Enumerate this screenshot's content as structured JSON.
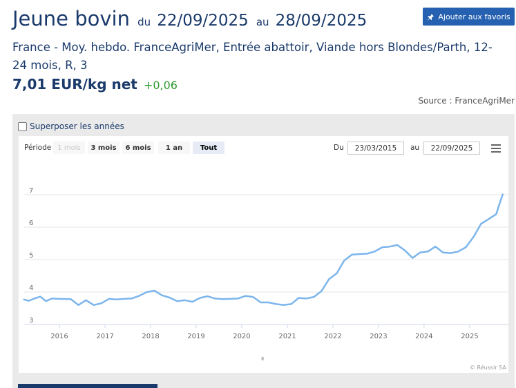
{
  "header": {
    "title": "Jeune bovin",
    "du_label": "du",
    "date_from": "22/09/2025",
    "au_label": "au",
    "date_to": "28/09/2025",
    "favorites_button": "Ajouter aux favoris",
    "subtitle": "France - Moy. hebdo. FranceAgriMer, Entrée abattoir, Viande hors Blondes/Parth, 12-24 mois, R, 3",
    "price": "7,01 EUR/kg net",
    "change": "+0,06",
    "source": "Source : FranceAgriMer"
  },
  "controls": {
    "overlay_years": "Superposer les années",
    "periode_label": "Période",
    "ranges": [
      "1 mois",
      "3 mois",
      "6 mois",
      "1 an",
      "Tout"
    ],
    "selected_range": "Tout",
    "du_label": "Du",
    "from_value": "23/03/2015",
    "au_label": "au",
    "to_value": "22/09/2025",
    "credit": "© Réussir SA",
    "navigator_handle": "III"
  },
  "colors": {
    "brand": "#1a3a6b",
    "button": "#2561b0",
    "positive": "#2e9a2e",
    "series": "#7cb5ec"
  },
  "chart_data": {
    "type": "line",
    "title": "",
    "xlabel": "",
    "ylabel": "",
    "ylim": [
      3,
      7
    ],
    "yticks": [
      3,
      4,
      5,
      6,
      7
    ],
    "xticks": [
      "2016",
      "2017",
      "2018",
      "2019",
      "2020",
      "2021",
      "2022",
      "2023",
      "2024",
      "2025"
    ],
    "grid": true,
    "series": [
      {
        "name": "",
        "x": [
          "2015-03-23",
          "2015-05-01",
          "2015-06-15",
          "2015-08-01",
          "2015-09-15",
          "2015-11-01",
          "2016-01-01",
          "2016-04-01",
          "2016-06-01",
          "2016-08-01",
          "2016-10-01",
          "2016-12-01",
          "2017-02-01",
          "2017-04-01",
          "2017-06-01",
          "2017-08-01",
          "2017-10-01",
          "2017-12-01",
          "2018-02-01",
          "2018-04-01",
          "2018-06-01",
          "2018-08-01",
          "2018-10-01",
          "2018-12-01",
          "2019-02-01",
          "2019-04-01",
          "2019-06-01",
          "2019-08-01",
          "2019-10-01",
          "2019-12-01",
          "2020-02-01",
          "2020-04-01",
          "2020-06-01",
          "2020-08-01",
          "2020-10-01",
          "2020-12-01",
          "2021-02-01",
          "2021-04-01",
          "2021-06-01",
          "2021-08-01",
          "2021-10-01",
          "2021-12-01",
          "2022-02-01",
          "2022-04-01",
          "2022-06-01",
          "2022-08-01",
          "2022-10-01",
          "2022-12-01",
          "2023-02-01",
          "2023-04-01",
          "2023-06-01",
          "2023-08-01",
          "2023-10-01",
          "2023-12-01",
          "2024-02-01",
          "2024-04-01",
          "2024-06-01",
          "2024-08-01",
          "2024-10-01",
          "2024-12-01",
          "2025-02-01",
          "2025-04-01",
          "2025-06-01",
          "2025-08-01",
          "2025-09-22"
        ],
        "values": [
          3.77,
          3.73,
          3.8,
          3.86,
          3.72,
          3.8,
          3.79,
          3.78,
          3.6,
          3.75,
          3.6,
          3.65,
          3.79,
          3.77,
          3.79,
          3.8,
          3.88,
          4.0,
          4.04,
          3.9,
          3.83,
          3.72,
          3.75,
          3.7,
          3.82,
          3.87,
          3.8,
          3.78,
          3.79,
          3.8,
          3.88,
          3.85,
          3.68,
          3.68,
          3.63,
          3.6,
          3.63,
          3.82,
          3.8,
          3.85,
          4.03,
          4.4,
          4.58,
          4.97,
          5.15,
          5.17,
          5.18,
          5.25,
          5.38,
          5.4,
          5.45,
          5.28,
          5.05,
          5.22,
          5.25,
          5.4,
          5.22,
          5.2,
          5.25,
          5.38,
          5.7,
          6.1,
          6.25,
          6.4,
          7.01
        ]
      }
    ]
  }
}
